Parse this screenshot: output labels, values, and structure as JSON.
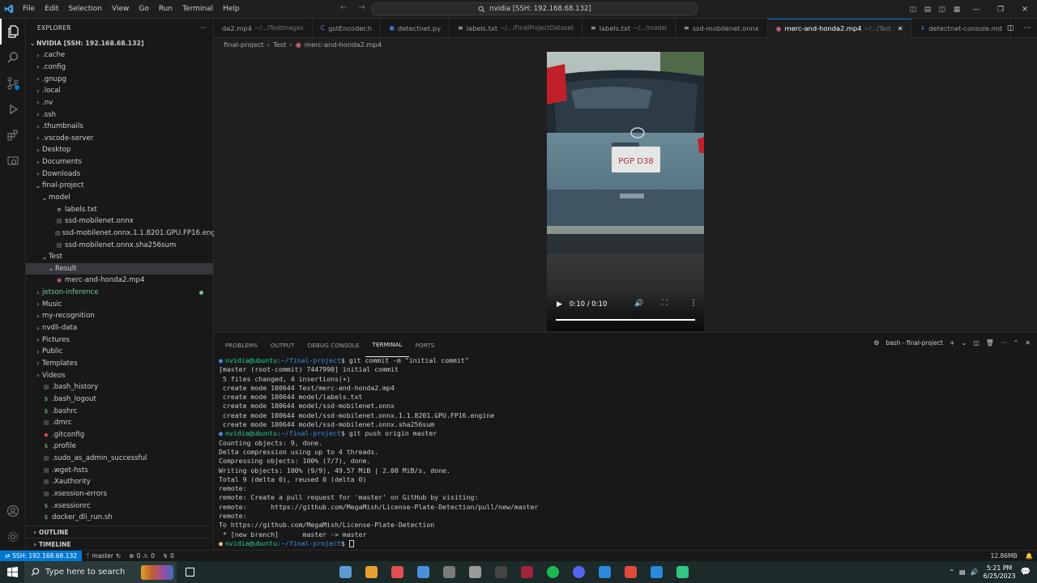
{
  "titlebar": {
    "menu": [
      "File",
      "Edit",
      "Selection",
      "View",
      "Go",
      "Run",
      "Terminal",
      "Help"
    ],
    "search": "nvidia [SSH: 192.168.68.132]"
  },
  "explorer": {
    "header": "EXPLORER",
    "root": "NVIDIA [SSH: 192.168.68.132]",
    "items": [
      {
        "label": ".cache",
        "type": "folder",
        "depth": 1
      },
      {
        "label": ".config",
        "type": "folder",
        "depth": 1
      },
      {
        "label": ".gnupg",
        "type": "folder",
        "depth": 1
      },
      {
        "label": ".local",
        "type": "folder",
        "depth": 1
      },
      {
        "label": ".nv",
        "type": "folder",
        "depth": 1
      },
      {
        "label": ".ssh",
        "type": "folder",
        "depth": 1
      },
      {
        "label": ".thumbnails",
        "type": "folder",
        "depth": 1
      },
      {
        "label": ".vscode-server",
        "type": "folder",
        "depth": 1
      },
      {
        "label": "Desktop",
        "type": "folder",
        "depth": 1
      },
      {
        "label": "Documents",
        "type": "folder",
        "depth": 1
      },
      {
        "label": "Downloads",
        "type": "folder",
        "depth": 1
      },
      {
        "label": "final-project",
        "type": "folder-open",
        "depth": 1
      },
      {
        "label": "model",
        "type": "folder-open",
        "depth": 2
      },
      {
        "label": "labels.txt",
        "type": "file-txt",
        "depth": 3
      },
      {
        "label": "ssd-mobilenet.onnx",
        "type": "file",
        "depth": 3
      },
      {
        "label": "ssd-mobilenet.onnx.1.1.8201.GPU.FP16.engine",
        "type": "file",
        "depth": 3
      },
      {
        "label": "ssd-mobilenet.onnx.sha256sum",
        "type": "file",
        "depth": 3
      },
      {
        "label": "Test",
        "type": "folder-open",
        "depth": 2
      },
      {
        "label": "Result",
        "type": "folder-open",
        "depth": 3,
        "selected": true
      },
      {
        "label": "merc-and-honda2.mp4",
        "type": "file-media",
        "depth": 3
      },
      {
        "label": "jetson-inference",
        "type": "folder",
        "depth": 1,
        "git": true
      },
      {
        "label": "Music",
        "type": "folder",
        "depth": 1
      },
      {
        "label": "my-recognition",
        "type": "folder",
        "depth": 1
      },
      {
        "label": "nvdli-data",
        "type": "folder",
        "depth": 1
      },
      {
        "label": "Pictures",
        "type": "folder",
        "depth": 1
      },
      {
        "label": "Public",
        "type": "folder",
        "depth": 1
      },
      {
        "label": "Templates",
        "type": "folder",
        "depth": 1
      },
      {
        "label": "Videos",
        "type": "folder",
        "depth": 1
      },
      {
        "label": ".bash_history",
        "type": "file",
        "depth": 1
      },
      {
        "label": ".bash_logout",
        "type": "file-shell",
        "depth": 1
      },
      {
        "label": ".bashrc",
        "type": "file-shell",
        "depth": 1
      },
      {
        "label": ".dmrc",
        "type": "file",
        "depth": 1
      },
      {
        "label": ".gitconfig",
        "type": "file-git",
        "depth": 1
      },
      {
        "label": ".profile",
        "type": "file-shell",
        "depth": 1
      },
      {
        "label": ".sudo_as_admin_successful",
        "type": "file",
        "depth": 1
      },
      {
        "label": ".wget-hsts",
        "type": "file",
        "depth": 1
      },
      {
        "label": ".Xauthority",
        "type": "file",
        "depth": 1
      },
      {
        "label": ".xsession-errors",
        "type": "file",
        "depth": 1
      },
      {
        "label": ".xsessionrc",
        "type": "file-shell",
        "depth": 1
      },
      {
        "label": "docker_dli_run.sh",
        "type": "file-shell",
        "depth": 1
      }
    ],
    "outline": "OUTLINE",
    "timeline": "TIMELINE"
  },
  "tabs": [
    {
      "label": "da2.mp4",
      "desc": "~/.../TestImages",
      "icon": "media",
      "color": "#e06c75"
    },
    {
      "label": "gstEncoder.h",
      "desc": "",
      "icon": "C",
      "color": "#a074c4"
    },
    {
      "label": "detectnet.py",
      "desc": "",
      "icon": "py",
      "color": "#3b8eea"
    },
    {
      "label": "labels.txt",
      "desc": "~/.../FinalProjectDataset",
      "icon": "txt",
      "color": "#cccccc"
    },
    {
      "label": "labels.txt",
      "desc": "~/.../model",
      "icon": "txt",
      "color": "#cccccc"
    },
    {
      "label": "ssd-mobilenet.onnx",
      "desc": "",
      "icon": "bin",
      "color": "#cccccc"
    },
    {
      "label": "merc-and-honda2.mp4",
      "desc": "~/.../Test",
      "icon": "media",
      "color": "#e06c75",
      "active": true
    },
    {
      "label": "detectnet-console.md",
      "desc": "",
      "icon": "md",
      "color": "#3b8eea"
    }
  ],
  "breadcrumb": [
    "final-project",
    "Test",
    "merc-and-honda2.mp4"
  ],
  "video": {
    "time": "0:10 / 0:10",
    "plate": "PGP D38",
    "progress": 1.0
  },
  "panel": {
    "tabs": [
      "PROBLEMS",
      "OUTPUT",
      "DEBUG CONSOLE",
      "TERMINAL",
      "PORTS"
    ],
    "active_tab": "TERMINAL",
    "terminal_name": "bash - final-project"
  },
  "terminal": {
    "user": "nvidia@ubuntu",
    "path": ":~/final-project",
    "lines": [
      {
        "prompt": true,
        "cmd": "git commit -m \"initial commit\""
      },
      {
        "text": "[master (root-commit) 7447990] initial commit"
      },
      {
        "text": " 5 files changed, 4 insertions(+)"
      },
      {
        "text": " create mode 100644 Test/merc-and-honda2.mp4"
      },
      {
        "text": " create mode 100644 model/labels.txt"
      },
      {
        "text": " create mode 100644 model/ssd-mobilenet.onnx"
      },
      {
        "text": " create mode 100644 model/ssd-mobilenet.onnx.1.1.8201.GPU.FP16.engine"
      },
      {
        "text": " create mode 100644 model/ssd-mobilenet.onnx.sha256sum"
      },
      {
        "prompt": true,
        "cmd": "git push origin master"
      },
      {
        "text": "Counting objects: 9, done."
      },
      {
        "text": "Delta compression using up to 4 threads."
      },
      {
        "text": "Compressing objects: 100% (7/7), done."
      },
      {
        "text": "Writing objects: 100% (9/9), 49.57 MiB | 2.00 MiB/s, done."
      },
      {
        "text": "Total 9 (delta 0), reused 0 (delta 0)"
      },
      {
        "text": "remote:"
      },
      {
        "text": "remote: Create a pull request for 'master' on GitHub by visiting:"
      },
      {
        "text": "remote:      https://github.com/MegaMish/License-Plate-Detection/pull/new/master"
      },
      {
        "text": "remote:"
      },
      {
        "text": "To https://github.com/MegaMish/License-Plate-Detection"
      },
      {
        "text": " * [new branch]      master -> master"
      },
      {
        "prompt": true,
        "cmd": "",
        "cursor": true
      }
    ]
  },
  "statusbar": {
    "remote": "SSH: 192.168.68.132",
    "branch": "master",
    "errors": "0",
    "warnings": "0",
    "ports": "0",
    "size": "12.86MB"
  },
  "taskbar": {
    "search_placeholder": "Type here to search",
    "time": "5:21 PM",
    "date": "6/25/2023",
    "apps": [
      "#5b9bd5",
      "#e8a030",
      "#e05050",
      "#4a90d9",
      "#7a7a7a",
      "#9a9a9a",
      "#444444",
      "#a0243a",
      "#1db954",
      "#5865f2",
      "#2a8ad9",
      "#e04a3a",
      "#2a8ad9",
      "#33c481"
    ]
  }
}
